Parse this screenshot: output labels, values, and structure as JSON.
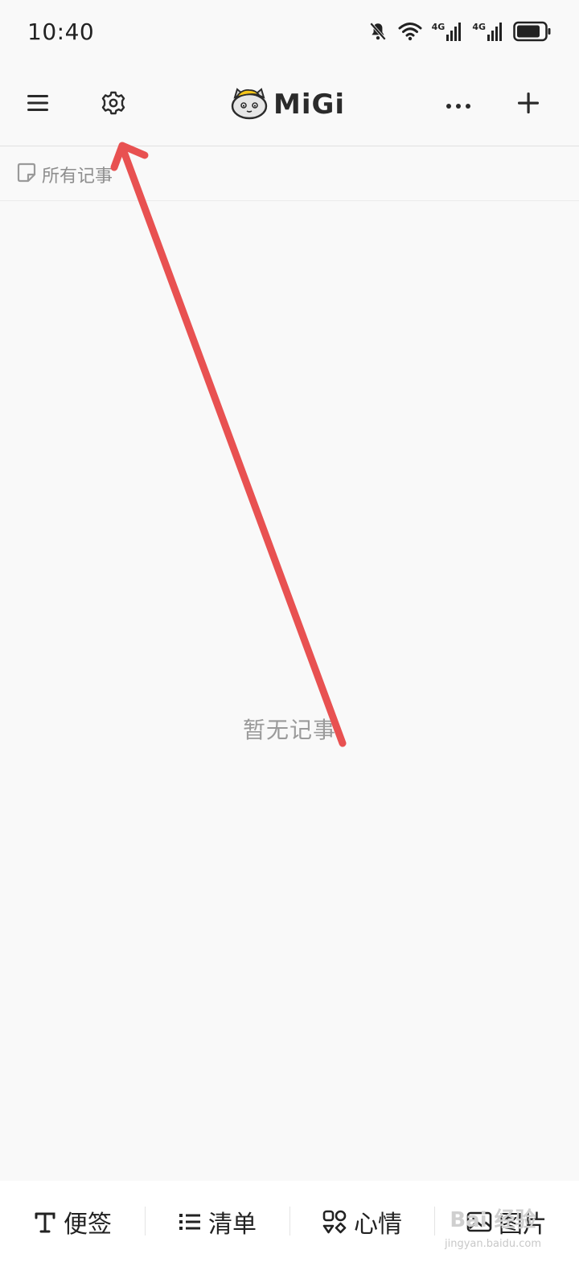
{
  "status_bar": {
    "time": "10:40",
    "icons": [
      "bell-off-icon",
      "wifi-icon",
      "signal-4g-icon",
      "signal-4g-icon",
      "battery-icon"
    ],
    "network_labels": [
      "4G",
      "4G"
    ]
  },
  "app_bar": {
    "brand_name": "MiGi",
    "left_icons": [
      "menu-icon",
      "gear-icon"
    ],
    "right_icons": [
      "more-icon",
      "plus-icon"
    ]
  },
  "filter": {
    "label": "所有记事",
    "icon": "note-icon"
  },
  "main": {
    "empty_text": "暂无记事"
  },
  "bottom_bar": {
    "tabs": [
      {
        "label": "便签",
        "icon": "text-icon"
      },
      {
        "label": "清单",
        "icon": "list-icon"
      },
      {
        "label": "心情",
        "icon": "mood-icon"
      },
      {
        "label": "图片",
        "icon": "image-icon"
      }
    ]
  },
  "watermark": {
    "title": "Bai 经验",
    "subtitle": "jingyan.baidu.com"
  },
  "colors": {
    "background": "#f9f9f9",
    "annotation_arrow": "#e85151",
    "text_primary": "#222222",
    "text_muted": "#8e8e8e"
  }
}
